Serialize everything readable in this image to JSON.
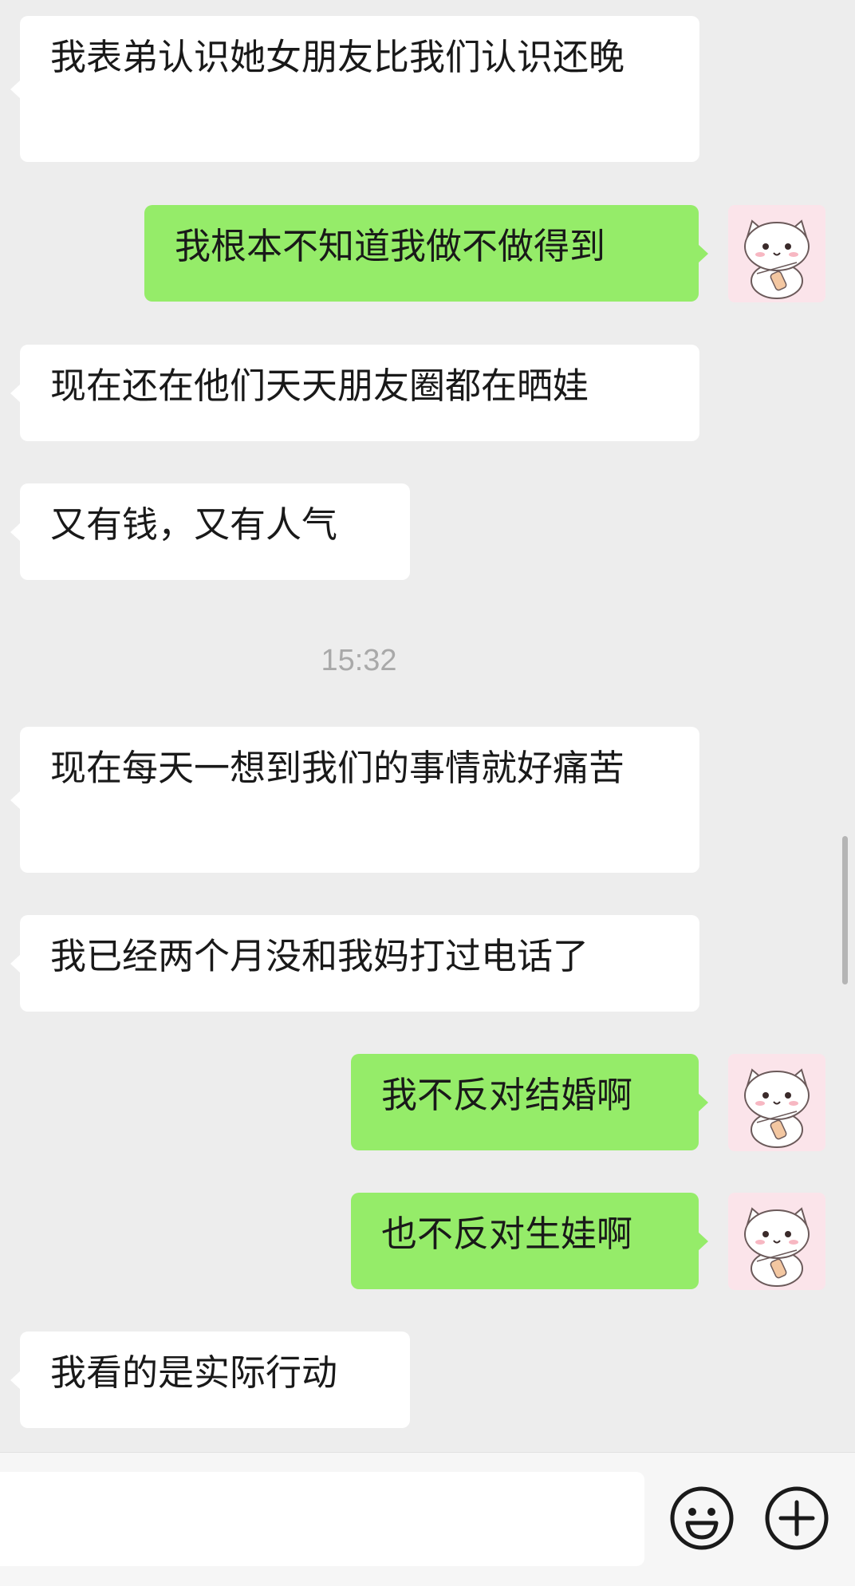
{
  "messages": [
    {
      "side": "left",
      "text": "我表弟认识她女朋友比我们认识还晚"
    },
    {
      "side": "right",
      "text": "我根本不知道我做不做得到"
    },
    {
      "side": "left",
      "text": "现在还在他们天天朋友圈都在晒娃"
    },
    {
      "side": "left",
      "text": "又有钱，又有人气"
    },
    {
      "side": "time",
      "text": "15:32"
    },
    {
      "side": "left",
      "text": "现在每天一想到我们的事情就好痛苦"
    },
    {
      "side": "left",
      "text": "我已经两个月没和我妈打过电话了"
    },
    {
      "side": "right",
      "text": "我不反对结婚啊"
    },
    {
      "side": "right",
      "text": "也不反对生娃啊"
    },
    {
      "side": "left",
      "text": "我看的是实际行动"
    }
  ],
  "avatar_icon": "cat-sticker-avatar",
  "input_bar": {
    "input_value": "",
    "emoji_icon": "emoji-icon",
    "plus_icon": "plus-circle-icon"
  },
  "colors": {
    "background": "#ededed",
    "bubble_self": "#95ec69",
    "bubble_other": "#ffffff",
    "timestamp": "#a9a9a9"
  }
}
